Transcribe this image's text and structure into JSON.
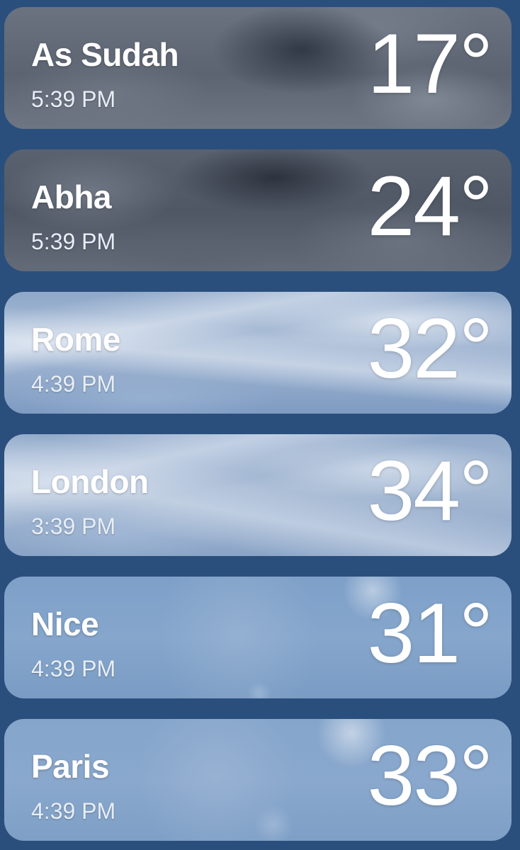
{
  "locations": [
    {
      "city": "As Sudah",
      "time": "5:39 PM",
      "temp": "17°"
    },
    {
      "city": "Abha",
      "time": "5:39 PM",
      "temp": "24°"
    },
    {
      "city": "Rome",
      "time": "4:39 PM",
      "temp": "32°"
    },
    {
      "city": "London",
      "time": "3:39 PM",
      "temp": "34°"
    },
    {
      "city": "Nice",
      "time": "4:39 PM",
      "temp": "31°"
    },
    {
      "city": "Paris",
      "time": "4:39 PM",
      "temp": "33°"
    }
  ],
  "colors": {
    "background": "#2a4f7c",
    "text": "#ffffff"
  }
}
